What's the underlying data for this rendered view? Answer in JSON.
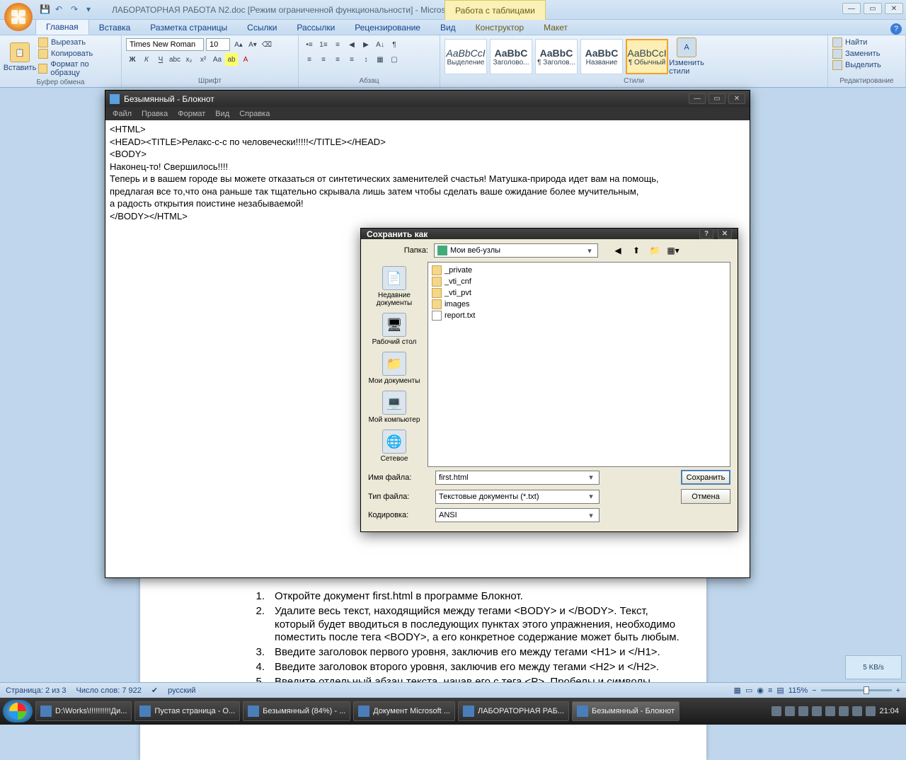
{
  "word": {
    "title": "ЛАБОРАТОРНАЯ РАБОТА N2.doc [Режим ограниченной функциональности] - Micros...",
    "table_tools": "Работа с таблицами",
    "tabs": [
      "Главная",
      "Вставка",
      "Разметка страницы",
      "Ссылки",
      "Рассылки",
      "Рецензирование",
      "Вид",
      "Конструктор",
      "Макет"
    ],
    "clipboard": {
      "paste": "Вставить",
      "cut": "Вырезать",
      "copy": "Копировать",
      "painter": "Формат по образцу",
      "label": "Буфер обмена"
    },
    "font": {
      "name": "Times New Roman",
      "size": "10",
      "label": "Шрифт"
    },
    "para_label": "Абзац",
    "styles_label": "Стили",
    "styles": [
      {
        "sample": "AaBbCcI",
        "name": "Выделение"
      },
      {
        "sample": "AaBbC",
        "name": "Заголово..."
      },
      {
        "sample": "AaBbC",
        "name": "¶ Заголов..."
      },
      {
        "sample": "AaBbC",
        "name": "Название"
      },
      {
        "sample": "AaBbCcI",
        "name": "¶ Обычный"
      }
    ],
    "change_styles": "Изменить стили",
    "editing": {
      "find": "Найти",
      "replace": "Заменить",
      "select": "Выделить",
      "label": "Редактирование"
    }
  },
  "notepad": {
    "title": "Безымянный - Блокнот",
    "menu": [
      "Файл",
      "Правка",
      "Формат",
      "Вид",
      "Справка"
    ],
    "lines": [
      "<HTML>",
      "<HEAD><TITLE>Релакс-с-с по человечески!!!!!</TITLE></HEAD>",
      "<BODY>",
      "Наконец-то! Свершилось!!!!",
      "Теперь и в вашем городе вы можете отказаться от синтетических заменителей счастья! Матушка-природа идет вам на помощь,",
      "предлагая все то,что она раньше так тщательно скрывала лишь затем чтобы сделать ваше ожидание более мучительным,",
      "а радость открытия поистине незабываемой!",
      "</BODY></HTML>"
    ]
  },
  "saveas": {
    "title": "Сохранить как",
    "folder_label": "Папка:",
    "folder_value": "Мои веб-узлы",
    "places": [
      "Недавние документы",
      "Рабочий стол",
      "Мои документы",
      "Мой компьютер",
      "Сетевое"
    ],
    "files": [
      {
        "type": "folder",
        "name": "_private"
      },
      {
        "type": "folder",
        "name": "_vti_cnf"
      },
      {
        "type": "folder",
        "name": "_vti_pvt"
      },
      {
        "type": "folder",
        "name": "images"
      },
      {
        "type": "file",
        "name": "report.txt"
      }
    ],
    "filename_label": "Имя файла:",
    "filename_value": "first.html",
    "filetype_label": "Тип файла:",
    "filetype_value": "Текстовые документы (*.txt)",
    "encoding_label": "Кодировка:",
    "encoding_value": "ANSI",
    "save_btn": "Сохранить",
    "cancel_btn": "Отмена"
  },
  "document": {
    "items": [
      {
        "n": "1.",
        "t": "Откройте документ first.html в программе Блокнот."
      },
      {
        "n": "2.",
        "t": "Удалите весь текст, находящийся между тегами <BODY> и </BODY>.  Текст, который будет вводиться в последующих пунктах этого упражнения, необходимо поместить после тега <BODY>, а его конкретное содержание может быть любым."
      },
      {
        "n": "3.",
        "t": "Введите заголовок первого уровня, заключив его между тегами <H1> и </H1>."
      },
      {
        "n": "4.",
        "t": "Введите заголовок второго уровня, заключив его между тегами <H2> и </H2>."
      },
      {
        "n": "5.",
        "t": "Введите отдельный абзац текста, начав его с тега <P>.  Пробелы и символы перевода строки можно"
      }
    ]
  },
  "statusbar": {
    "page": "Страница: 2 из 3",
    "words": "Число слов: 7 922",
    "lang": "русский",
    "zoom": "115%"
  },
  "taskbar": {
    "items": [
      "D:\\Works\\!!!!!!!!!!Ди...",
      "Пустая страница - O...",
      "Безымянный (84%) - ...",
      "Документ Microsoft ...",
      "ЛАБОРАТОРНАЯ РАБ...",
      "Безымянный - Блокнот"
    ],
    "speed": "5 KB/s",
    "clock": "21:04"
  }
}
